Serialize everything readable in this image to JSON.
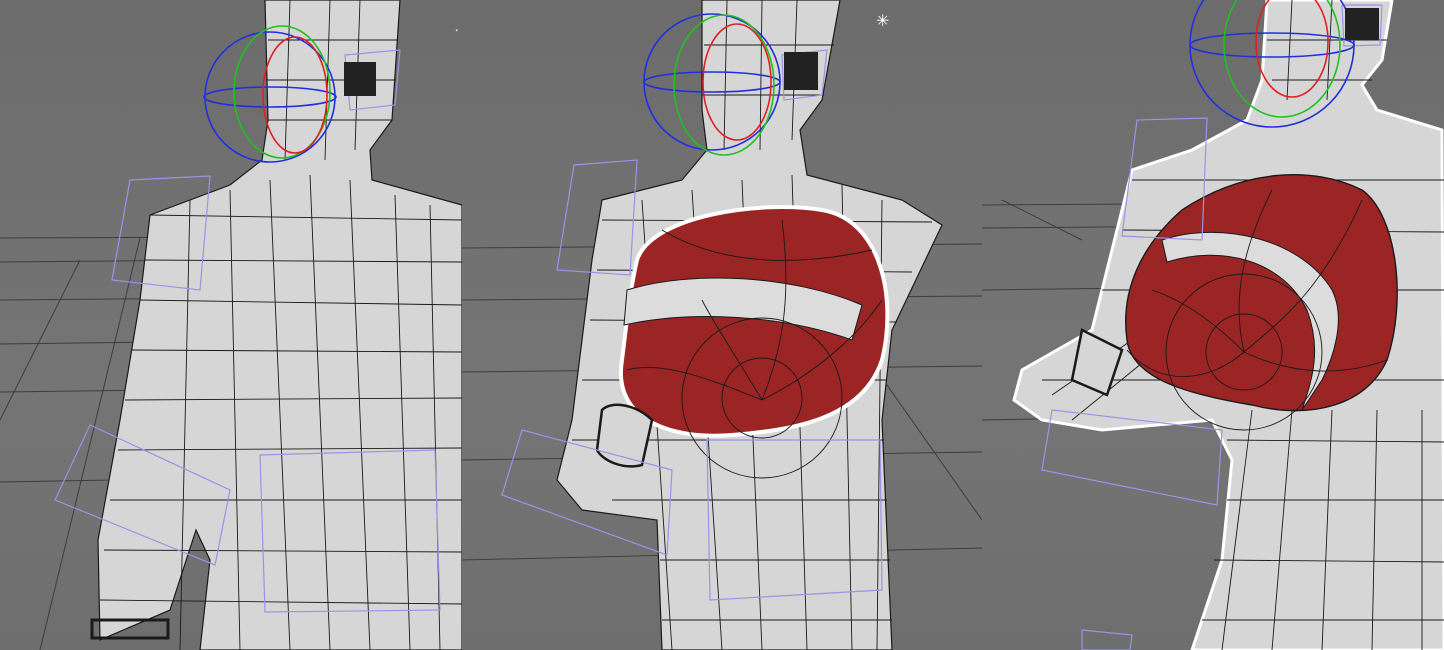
{
  "viewports": [
    {
      "id": "left",
      "glove_visible": false
    },
    {
      "id": "middle",
      "glove_visible": true,
      "glove_selected": true
    },
    {
      "id": "right",
      "glove_visible": true,
      "glove_selected": true
    }
  ],
  "colors": {
    "background": "#707070",
    "mesh_fill": "#d9d9d9",
    "wireframe": "#1a1a1a",
    "glove": "#9b2424",
    "glove_stripe": "#dcdcdc",
    "selection_outline": "#ffffff",
    "control_curves": "#9a93e8",
    "rotate_x": "#e02020",
    "rotate_y": "#20c020",
    "rotate_z": "#2030e0"
  },
  "icons": [
    "rotate-manipulator-icon",
    "bone-locator-icon",
    "light-sparkle-icon"
  ]
}
